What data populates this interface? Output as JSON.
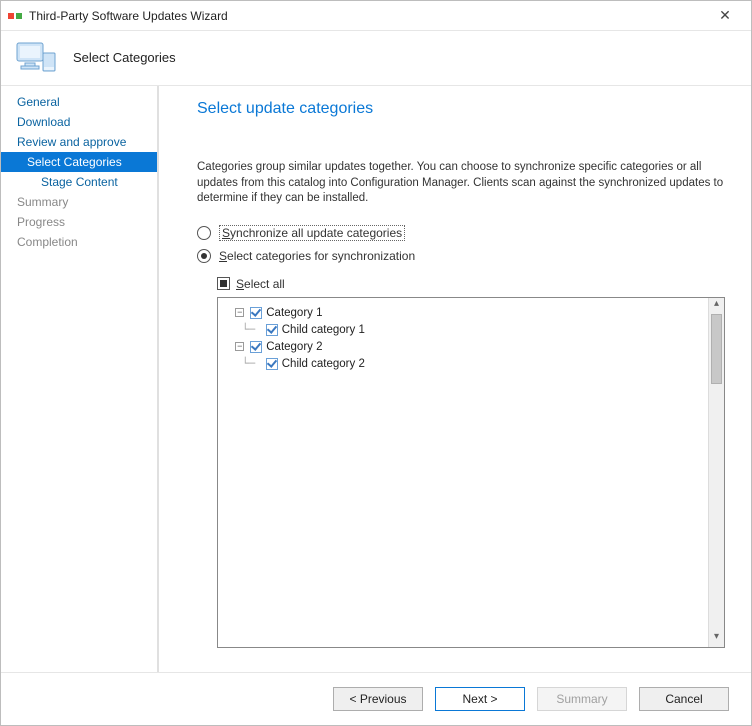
{
  "window": {
    "title": "Third-Party Software Updates Wizard"
  },
  "header": {
    "subtitle": "Select Categories"
  },
  "sidebar": {
    "items": [
      {
        "label": "General"
      },
      {
        "label": "Download"
      },
      {
        "label": "Review and approve"
      },
      {
        "label": "Select Categories"
      },
      {
        "label": "Stage Content"
      },
      {
        "label": "Summary"
      },
      {
        "label": "Progress"
      },
      {
        "label": "Completion"
      }
    ]
  },
  "main": {
    "title": "Select update categories",
    "description": "Categories group similar updates together. You can choose to synchronize specific categories or all updates from this catalog into Configuration Manager. Clients scan against the synchronized updates to determine if they can be installed.",
    "radio_all_prefix": "S",
    "radio_all_rest": "ynchronize all update categories",
    "radio_sel_prefix": "S",
    "radio_sel_rest": "elect categories for synchronization",
    "select_all_prefix": "S",
    "select_all_rest": "elect all",
    "tree": {
      "cat1": "Category 1",
      "cat1_child": "Child category 1",
      "cat2": "Category 2",
      "cat2_child": "Child category 2",
      "expander": "−"
    }
  },
  "footer": {
    "previous": "< Previous",
    "next": "Next >",
    "summary": "Summary",
    "cancel": "Cancel"
  }
}
